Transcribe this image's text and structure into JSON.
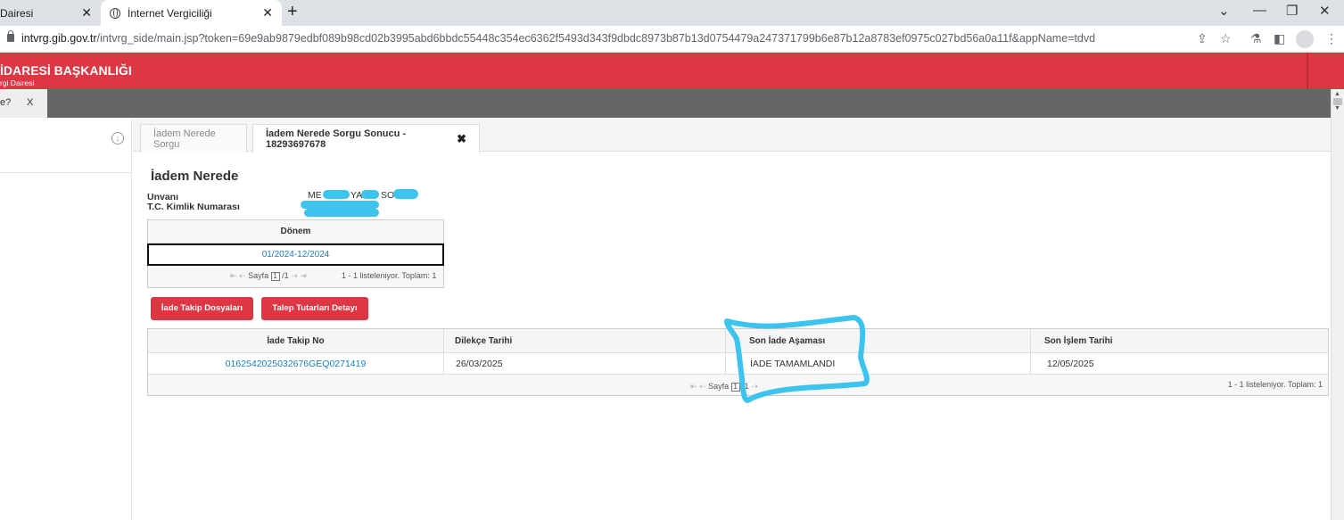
{
  "browser": {
    "tabs": [
      {
        "title": "Dairesi"
      },
      {
        "title": "İnternet Vergiciliği"
      }
    ],
    "new_tab": "+",
    "url_host": "intvrg.gib.gov.tr",
    "url_path": "/intvrg_side/main.jsp?token=69e9ab9879edbf089b98cd02b3995abd6bbdc55448c354ec6362f5493d343f9dbdc8973b87b13d0754479a247371799b6e87b12a8783ef0975c027bd56a0a11f&appName=tdvd",
    "controls": {
      "minimize": "—",
      "restore": "❐",
      "close": "✕",
      "chevron": "⌄"
    }
  },
  "site": {
    "title": "İDARESİ BAŞKANLIĞI",
    "subtitle": "rgi Dairesi"
  },
  "darkbar": {
    "left_tab": "e?",
    "left_tab_close": "X"
  },
  "tabs": {
    "tab1": "İadem Nerede Sorgu",
    "tab2": "İadem Nerede Sorgu Sonucu - 18293697678",
    "close": "✖"
  },
  "page": {
    "title": "İadem Nerede",
    "unvan_label": "Unvanı",
    "unvan_value_parts": [
      "ME",
      "YA",
      "SO"
    ],
    "tckn_label": "T.C. Kimlik Numarası"
  },
  "period_grid": {
    "header": "Dönem",
    "rows": [
      "01/2024-12/2024"
    ],
    "pager": {
      "page_label": "Sayfa",
      "page": "1",
      "of": "/1",
      "summary": "1 - 1 listeleniyor. Toplam: 1"
    }
  },
  "buttons": {
    "iade_takip": "İade Takip Dosyaları",
    "talep_tutar": "Talep Tutarları Detayı"
  },
  "table": {
    "headers": [
      "İade Takip No",
      "Dilekçe Tarihi",
      "Son İade Aşaması",
      "Son İşlem Tarihi"
    ],
    "rows": [
      [
        "0162542025032676GEQ0271419",
        "26/03/2025",
        "İADE TAMAMLANDI",
        "12/05/2025"
      ]
    ],
    "pager": {
      "page_label": "Sayfa",
      "page": "1",
      "of": "/1",
      "summary": "1 - 1 listeleniyor. Toplam: 1"
    }
  },
  "annotation_color": "#3cc4ef",
  "header_color": "#dd3744"
}
